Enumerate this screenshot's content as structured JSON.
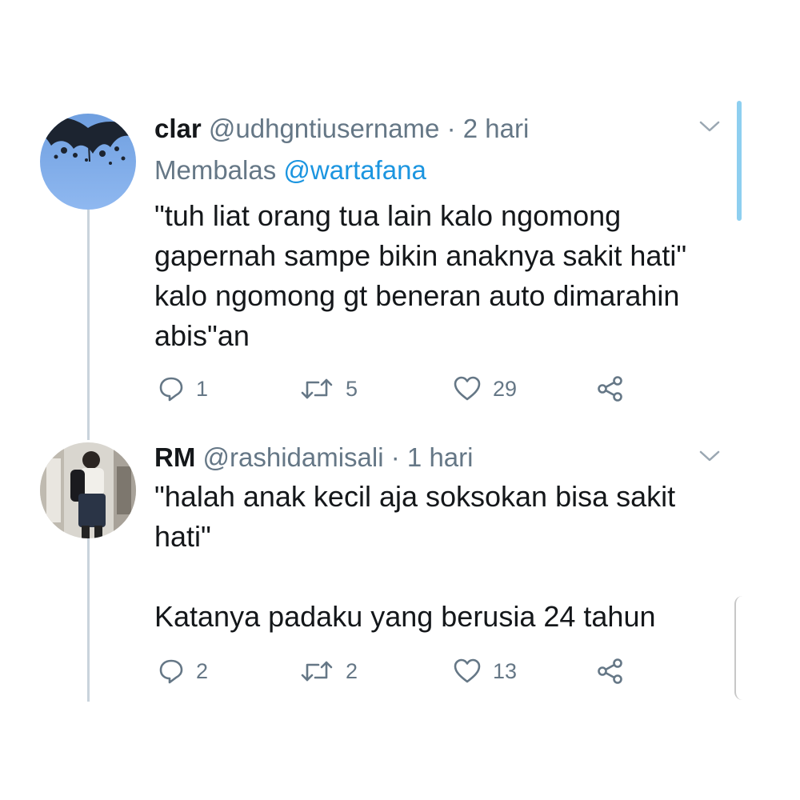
{
  "tweets": [
    {
      "display_name": "clar",
      "handle": "@udhgntiusername",
      "separator": "·",
      "time": "2 hari",
      "reply_prefix": "Membalas",
      "reply_to": "@wartafana",
      "text_lines": [
        "\"tuh liat orang tua lain kalo ngomong",
        "gapernah sampe bikin anaknya sakit hati\"",
        "kalo ngomong gt beneran auto dimarahin",
        "abis\"an"
      ],
      "reply_count": "1",
      "retweet_count": "5",
      "like_count": "29",
      "avatar_icon": "tree-sky-avatar"
    },
    {
      "display_name": "RM",
      "handle": "@rashidamisali",
      "separator": "·",
      "time": "1 hari",
      "text_lines": [
        "\"halah anak kecil aja soksokan bisa sakit",
        "hati\"",
        "",
        "Katanya padaku yang berusia 24 tahun"
      ],
      "reply_count": "2",
      "retweet_count": "2",
      "like_count": "13",
      "avatar_icon": "person-photo-avatar"
    }
  ],
  "icons": {
    "reply": "reply-icon",
    "retweet": "retweet-icon",
    "like": "heart-icon",
    "share": "share-icon",
    "menu": "chevron-down-icon"
  },
  "colors": {
    "text": "#14171a",
    "secondary": "#657786",
    "link": "#1b95e0",
    "thread_line": "#c9d3dc",
    "scroll": "#8ecff0"
  }
}
